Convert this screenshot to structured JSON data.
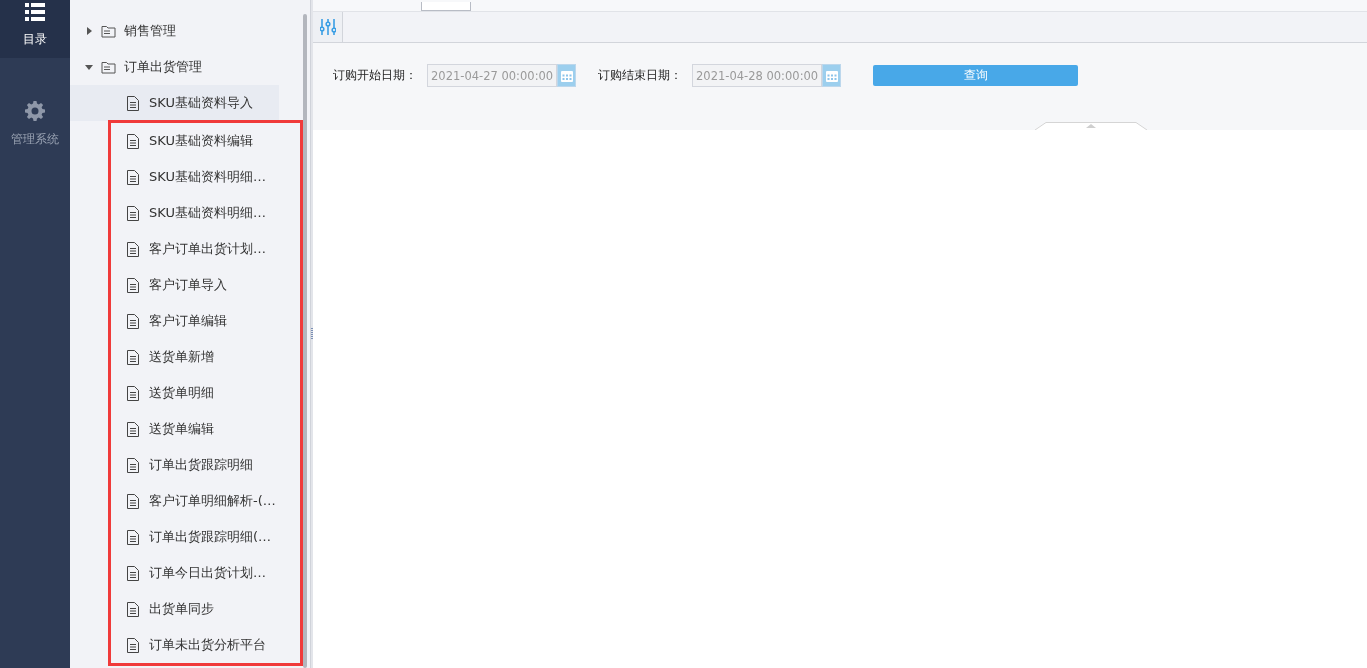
{
  "nav": [
    {
      "label": "目录",
      "selected": true,
      "kind": "list"
    },
    {
      "label": "管理系统",
      "selected": false,
      "kind": "gear"
    }
  ],
  "tree": [
    {
      "label": "销售管理",
      "expanded": false
    },
    {
      "label": "订单出货管理",
      "expanded": true,
      "children": [
        {
          "label": "SKU基础资料导入",
          "selected": true,
          "highlighted": false
        },
        {
          "label": "SKU基础资料编辑",
          "selected": false,
          "highlighted": true
        },
        {
          "label": "SKU基础资料明细…",
          "selected": false,
          "highlighted": true
        },
        {
          "label": "SKU基础资料明细…",
          "selected": false,
          "highlighted": true
        },
        {
          "label": "客户订单出货计划…",
          "selected": false,
          "highlighted": true
        },
        {
          "label": "客户订单导入",
          "selected": false,
          "highlighted": true
        },
        {
          "label": "客户订单编辑",
          "selected": false,
          "highlighted": true
        },
        {
          "label": "送货单新增",
          "selected": false,
          "highlighted": true
        },
        {
          "label": "送货单明细",
          "selected": false,
          "highlighted": true
        },
        {
          "label": "送货单编辑",
          "selected": false,
          "highlighted": true
        },
        {
          "label": "订单出货跟踪明细",
          "selected": false,
          "highlighted": true
        },
        {
          "label": "客户订单明细解析-(…",
          "selected": false,
          "highlighted": true
        },
        {
          "label": "订单出货跟踪明细(…",
          "selected": false,
          "highlighted": true
        },
        {
          "label": "订单今日出货计划…",
          "selected": false,
          "highlighted": true
        },
        {
          "label": "出货单同步",
          "selected": false,
          "highlighted": true
        },
        {
          "label": "订单未出货分析平台",
          "selected": false,
          "highlighted": true
        }
      ]
    }
  ],
  "filters": [
    {
      "label": "订购开始日期：",
      "value": "2021-04-27 00:00:00"
    },
    {
      "label": "订购结束日期：",
      "value": "2021-04-28 00:00:00"
    }
  ],
  "query_button": "查询"
}
